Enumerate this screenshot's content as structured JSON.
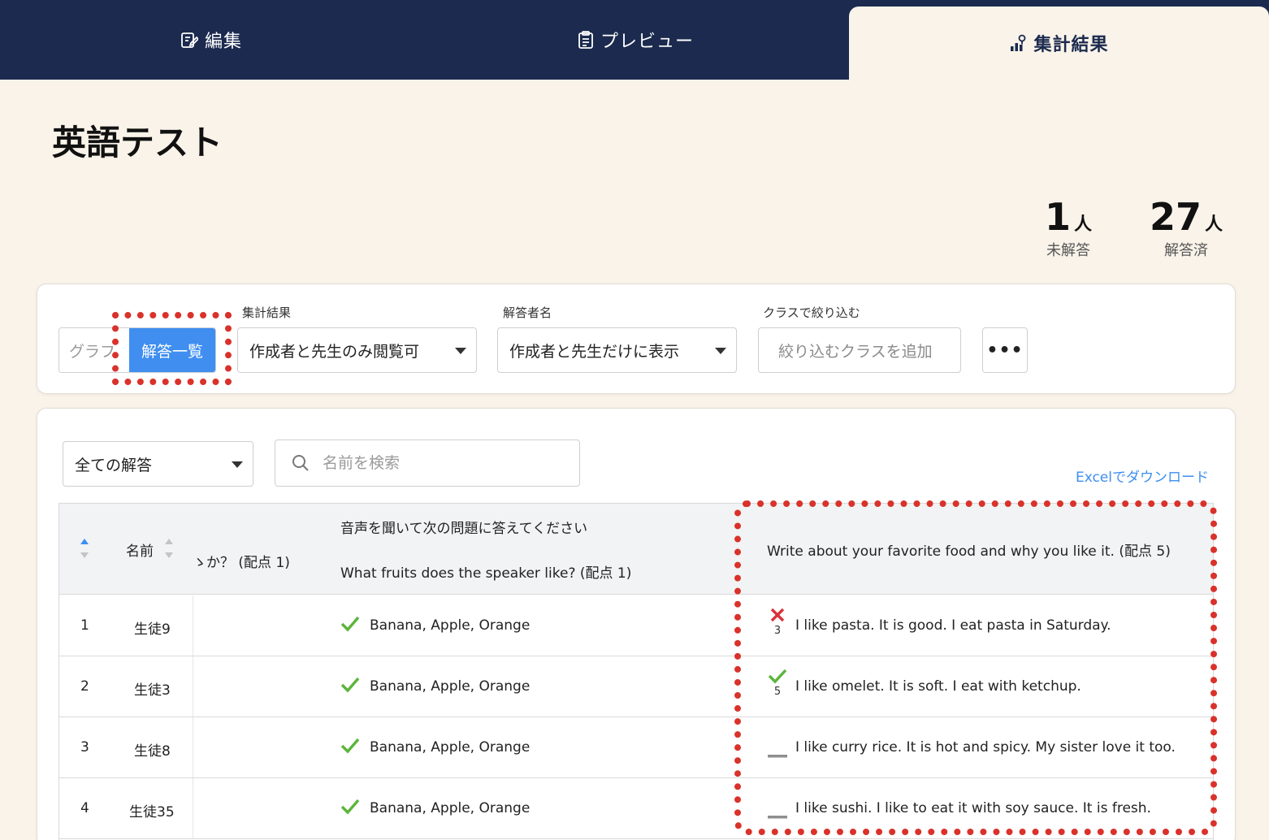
{
  "tabs": [
    {
      "label": "編集",
      "icon": "edit-icon"
    },
    {
      "label": "プレビュー",
      "icon": "clipboard-icon"
    },
    {
      "label": "集計結果",
      "icon": "chart-icon",
      "active": true
    }
  ],
  "page": {
    "title": "英語テスト"
  },
  "stats": {
    "unanswered": {
      "count": "1",
      "unit": "人",
      "label": "未解答"
    },
    "answered": {
      "count": "27",
      "unit": "人",
      "label": "解答済"
    }
  },
  "controls": {
    "view_toggle": {
      "graph": "グラフ",
      "list": "解答一覧",
      "selected": "解答一覧"
    },
    "results_visibility": {
      "label": "集計結果",
      "value": "作成者と先生のみ閲覧可"
    },
    "respondent_name": {
      "label": "解答者名",
      "value": "作成者と先生だけに表示"
    },
    "class_filter": {
      "label": "クラスで絞り込む",
      "placeholder": "絞り込むクラスを追加"
    },
    "more": "•••"
  },
  "table_controls": {
    "answer_filter": "全ての解答",
    "search_placeholder": "名前を検索",
    "excel_link": "Excelでダウンロード"
  },
  "table": {
    "headers": {
      "name": "名前",
      "partial_question": "ゝか？ (配点 1)",
      "q_audio_instruction": "音声を聞いて次の問題に答えてください",
      "q_audio": "What fruits does the speaker like? (配点 1)",
      "q_writing": "Write about your favorite food and why you like it. (配点 5)"
    },
    "rows": [
      {
        "no": "1",
        "name": "生徒9",
        "fruit_answer": "Banana, Apple, Orange",
        "fruit_status": "correct",
        "writing_status": "incorrect",
        "writing_score": "3",
        "writing_answer": "I like pasta. It is good. I eat pasta in Saturday."
      },
      {
        "no": "2",
        "name": "生徒3",
        "fruit_answer": "Banana, Apple, Orange",
        "fruit_status": "correct",
        "writing_status": "correct",
        "writing_score": "5",
        "writing_answer": "I like omelet. It is soft. I eat with ketchup."
      },
      {
        "no": "3",
        "name": "生徒8",
        "fruit_answer": "Banana, Apple, Orange",
        "fruit_status": "correct",
        "writing_status": "ungraded",
        "writing_score": "",
        "writing_answer": "I like curry rice. It is hot and spicy. My sister love it too."
      },
      {
        "no": "4",
        "name": "生徒35",
        "fruit_answer": "Banana, Apple, Orange",
        "fruit_status": "correct",
        "writing_status": "ungraded",
        "writing_score": "",
        "writing_answer": "I like sushi. I like to eat it with soy sauce. It is fresh."
      }
    ]
  },
  "colors": {
    "navy": "#1b2a4e",
    "accent": "#3f8ef0",
    "highlight": "#d9322b",
    "correct": "#5bb53a",
    "incorrect": "#d9323a",
    "background": "#faf3e9"
  }
}
